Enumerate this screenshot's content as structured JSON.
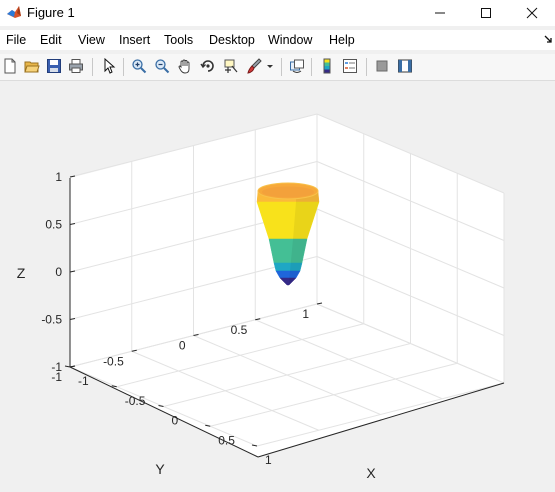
{
  "window": {
    "title": "Figure 1"
  },
  "menu": {
    "items": [
      "File",
      "Edit",
      "View",
      "Insert",
      "Tools",
      "Desktop",
      "Window",
      "Help"
    ]
  },
  "toolbar": {
    "buttons": [
      "new-figure-icon",
      "open-file-icon",
      "save-icon",
      "print-icon",
      "edit-plot-arrow-icon",
      "zoom-in-icon",
      "zoom-out-icon",
      "pan-hand-icon",
      "rotate-3d-icon",
      "data-cursor-icon",
      "brush-icon",
      "brush-dropdown-icon",
      "link-plot-icon",
      "insert-colorbar-icon",
      "insert-legend-icon",
      "hide-plot-tools-icon",
      "show-plot-tools-icon"
    ]
  },
  "axes": {
    "xlabel": "X",
    "ylabel": "Y",
    "zlabel": "Z",
    "x_ticks": [
      "-1",
      "-0.5",
      "0",
      "0.5",
      "1"
    ],
    "y_ticks": [
      "-1",
      "-0.5",
      "0",
      "0.5",
      "1"
    ],
    "z_ticks": [
      "-1",
      "-0.5",
      "0",
      "0.5",
      "1"
    ],
    "xlim": [
      -1,
      1
    ],
    "ylim": [
      -1,
      1
    ],
    "zlim": [
      -1,
      1
    ],
    "grid": true,
    "box": false
  },
  "surface": {
    "type": "cone-shaped 3-D surface",
    "colormap": "parula",
    "colors": [
      "#352a87",
      "#1f66db",
      "#1fa7c4",
      "#44bf95",
      "#b5c43a",
      "#f8e21b",
      "#fbba3a"
    ]
  }
}
